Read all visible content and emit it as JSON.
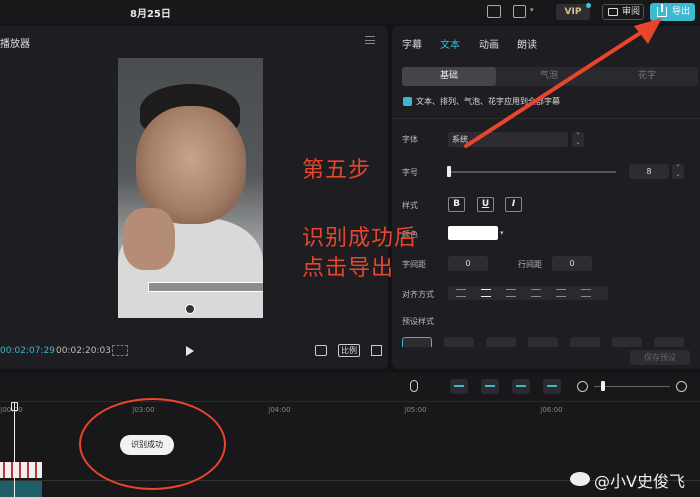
{
  "topbar": {
    "date": "8月25日",
    "vip": "VIP",
    "review": "审阅",
    "export": "导出"
  },
  "player": {
    "title": "播放器",
    "subtitle_text": "",
    "time_current": "00:02:07:29",
    "time_total": "00:02:20:03",
    "ratio": "比例"
  },
  "annotations": {
    "step": "第五步",
    "line1": "识别成功后",
    "line2": "点击导出"
  },
  "right_panel": {
    "tabs": [
      {
        "label": "字幕",
        "active": false
      },
      {
        "label": "文本",
        "active": true
      },
      {
        "label": "动画",
        "active": false
      },
      {
        "label": "朗读",
        "active": false
      }
    ],
    "segments": [
      "基础",
      "气泡",
      "花字"
    ],
    "apply_all_label": "文本、排列、气泡、花字应用到全部字幕",
    "font_label": "字体",
    "font_value": "系统",
    "size_label": "字号",
    "size_value": "8",
    "style_label": "样式",
    "style_buttons": [
      "B",
      "U",
      "I"
    ],
    "color_label": "颜色",
    "color_value": "#ffffff",
    "char_spacing_label": "字间距",
    "char_spacing_value": "0",
    "line_spacing_label": "行间距",
    "line_spacing_value": "0",
    "align_label": "对齐方式",
    "preset_label": "预设样式",
    "save_preset": "保存预设"
  },
  "timeline": {
    "ticks": [
      "|00:00",
      "|03:00",
      "|04:00",
      "|05:00",
      "|06:00"
    ],
    "recognition_badge": "识别成功"
  },
  "watermark": "@小V史俊飞",
  "colors": {
    "accent": "#3ab9cf",
    "annotation": "#e8452c"
  }
}
